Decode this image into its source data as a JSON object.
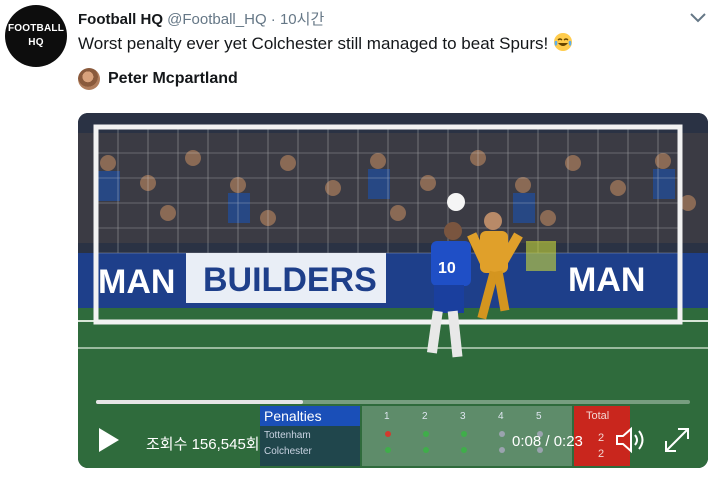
{
  "tweet": {
    "author_name": "Football HQ",
    "author_handle": "@Football_HQ",
    "separator": "·",
    "time": "10시간",
    "avatar_text_line1": "FOOTBALL",
    "avatar_text_line2": "HQ",
    "text": "Worst penalty ever yet Colchester still managed to beat Spurs!",
    "emoji": "face-with-tears-of-joy",
    "tagged_user": "Peter Mcpartland"
  },
  "video": {
    "views": "조회수 156,545회",
    "time_display": "0:08 / 0:23",
    "progress_fraction": 0.3478,
    "board_text": "BUILDERS",
    "board_text_left": "MAN",
    "board_text_right": "MAN",
    "player_number": "10",
    "colors": {
      "pitch": "#2f6b3c",
      "board_blue": "#1e3f8a",
      "player_shirt": "#1f4fc6",
      "keeper_kit": "#e0a02a"
    }
  },
  "scoreboard": {
    "title": "Penalties",
    "teams": [
      "Tottenham",
      "Colchester"
    ],
    "rounds": [
      "1",
      "2",
      "3",
      "4",
      "5"
    ],
    "total_label": "Total",
    "totals": [
      "2",
      "2"
    ],
    "results": [
      [
        "miss",
        "goal",
        "goal",
        "pending",
        "pending"
      ],
      [
        "goal",
        "goal",
        "goal",
        "pending",
        "pending"
      ]
    ]
  },
  "icons": {
    "more": "chevron-down-icon",
    "play": "play-icon",
    "volume": "volume-icon",
    "fullscreen": "fullscreen-icon"
  }
}
